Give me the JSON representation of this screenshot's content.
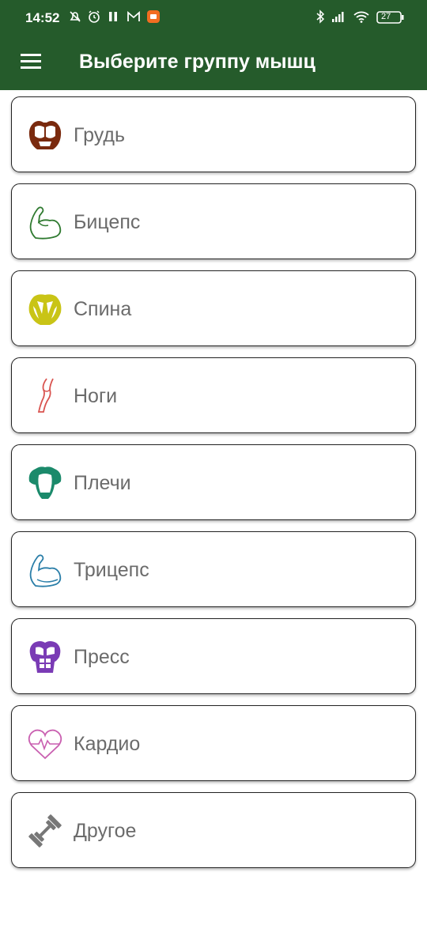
{
  "status_bar": {
    "time": "14:52",
    "battery_level": "27",
    "icons": [
      "silent-mode-icon",
      "alarm-icon",
      "pause-icon",
      "gmail-icon",
      "notification-app-icon",
      "bluetooth-icon",
      "signal-icon",
      "wifi-icon",
      "battery-icon"
    ]
  },
  "app_bar": {
    "title": "Выберите группу мышц",
    "menu_icon": "hamburger-menu-icon"
  },
  "muscle_groups": [
    {
      "label": "Грудь",
      "icon": "chest-icon",
      "color": "#7a2a0e"
    },
    {
      "label": "Бицепс",
      "icon": "biceps-icon",
      "color": "#2f7a30"
    },
    {
      "label": "Спина",
      "icon": "back-icon",
      "color": "#c9c416"
    },
    {
      "label": "Ноги",
      "icon": "legs-icon",
      "color": "#d9534f"
    },
    {
      "label": "Плечи",
      "icon": "shoulders-icon",
      "color": "#1b8a6b"
    },
    {
      "label": "Трицепс",
      "icon": "triceps-icon",
      "color": "#2a7ea8"
    },
    {
      "label": "Пресс",
      "icon": "abs-icon",
      "color": "#7a3bb5"
    },
    {
      "label": "Кардио",
      "icon": "heart-cardio-icon",
      "color": "#c95fb0"
    },
    {
      "label": "Другое",
      "icon": "dumbbell-icon",
      "color": "#777777"
    }
  ],
  "colors": {
    "app_bar": "#255b2b",
    "label_text": "#6b6b6b"
  }
}
